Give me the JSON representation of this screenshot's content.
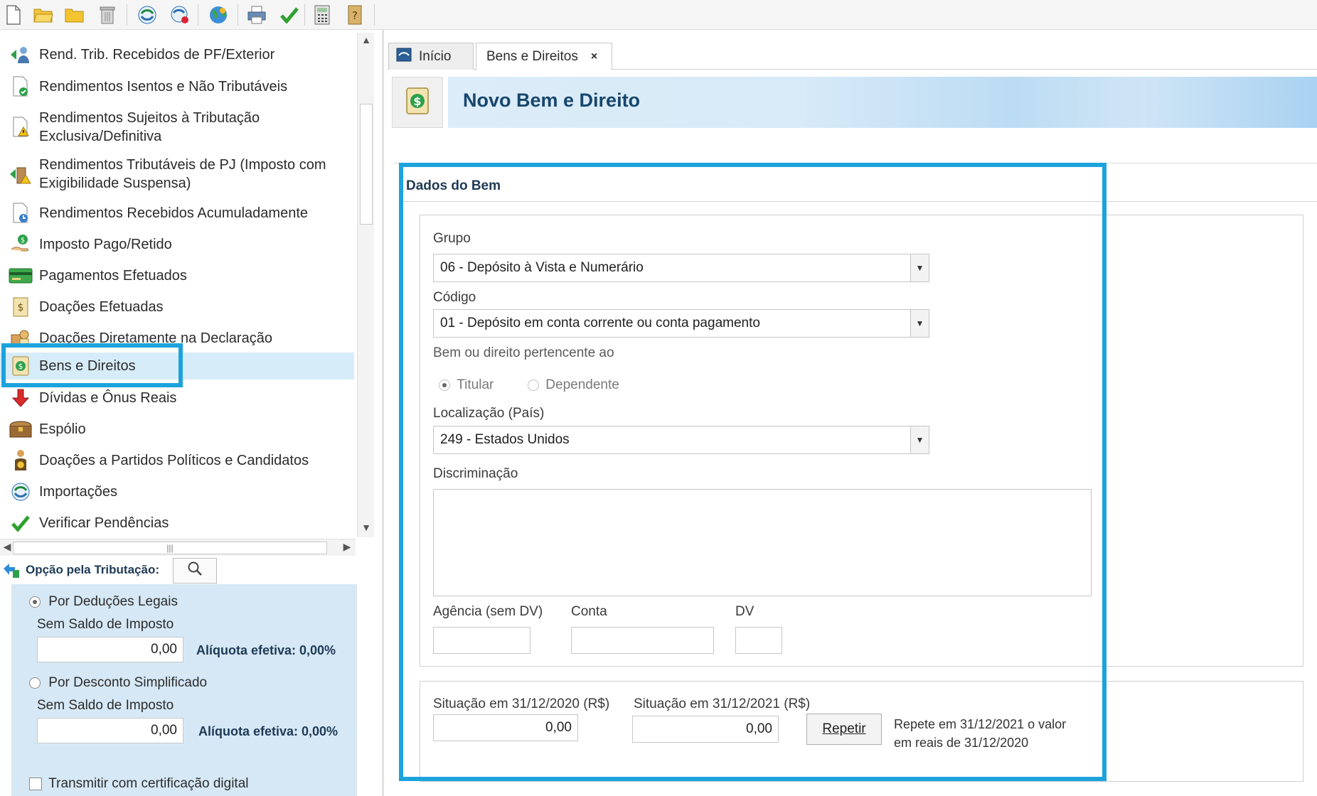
{
  "toolbar": {
    "icons": [
      "new-file-icon",
      "open-folder-icon",
      "folder-icon",
      "trash-icon",
      "import-icon",
      "receita-icon",
      "globe-icon",
      "print-icon",
      "check-icon",
      "calculator-icon",
      "help-icon"
    ]
  },
  "nav": {
    "items": [
      {
        "label": "Rend. Trib. Recebidos de PF/Exterior",
        "icon": "person-arrow-icon"
      },
      {
        "label": "Rendimentos Isentos e Não Tributáveis",
        "icon": "doc-check-icon"
      },
      {
        "label": "Rendimentos Sujeitos à Tributação",
        "label2": "Exclusiva/Definitiva",
        "icon": "doc-warning-icon"
      },
      {
        "label": "Rendimentos Tributáveis de PJ (Imposto com",
        "label2": "Exigibilidade Suspensa)",
        "icon": "building-arrow-icon"
      },
      {
        "label": "Rendimentos Recebidos Acumuladamente",
        "icon": "doc-clock-icon"
      },
      {
        "label": "Imposto Pago/Retido",
        "icon": "hand-coin-icon"
      },
      {
        "label": "Pagamentos Efetuados",
        "icon": "card-icon"
      },
      {
        "label": "Doações Efetuadas",
        "icon": "money-bag-icon"
      },
      {
        "label": "Doações Diretamente na Declaração",
        "icon": "donation-icon"
      },
      {
        "label": "Bens e Direitos",
        "icon": "dollar-doc-icon"
      },
      {
        "label": "Dívidas e Ônus Reais",
        "icon": "down-arrow-icon"
      },
      {
        "label": "Espólio",
        "icon": "chest-icon"
      },
      {
        "label": "Doações a Partidos Políticos e Candidatos",
        "icon": "person-coin-icon"
      },
      {
        "label": "Importações",
        "icon": "import-icon"
      },
      {
        "label": "Verificar Pendências",
        "icon": "check-icon"
      }
    ]
  },
  "opcao": {
    "title": "Opção pela Tributação:",
    "deducoes_label": "Por Deduções Legais",
    "deducoes_saldo": "Sem Saldo de Imposto",
    "deducoes_value": "0,00",
    "deducoes_aliquota": "Alíquota efetiva: 0,00%",
    "simplificado_label": "Por Desconto Simplificado",
    "simplificado_saldo": "Sem Saldo de Imposto",
    "simplificado_value": "0,00",
    "simplificado_aliquota": "Alíquota efetiva: 0,00%",
    "transmitir_label": "Transmitir com certificação digital"
  },
  "tabs": [
    {
      "label": "Início"
    },
    {
      "label": "Bens e Direitos",
      "close": "×"
    }
  ],
  "header": {
    "title": "Novo Bem e Direito"
  },
  "form": {
    "section_title": "Dados do Bem",
    "grupo_label": "Grupo",
    "grupo_value": "06 - Depósito à Vista e Numerário",
    "codigo_label": "Código",
    "codigo_value": "01 - Depósito em conta corrente ou conta pagamento",
    "pertencente_label": "Bem ou direito pertencente ao",
    "titular_label": "Titular",
    "dependente_label": "Dependente",
    "localizacao_label": "Localização (País)",
    "localizacao_value": "249 - Estados Unidos",
    "discriminacao_label": "Discriminação",
    "agencia_label": "Agência (sem DV)",
    "conta_label": "Conta",
    "dv_label": "DV",
    "situacao2020_label": "Situação em 31/12/2020 (R$)",
    "situacao2020_value": "0,00",
    "situacao2021_label": "Situação em 31/12/2021 (R$)",
    "situacao2021_value": "0,00",
    "repetir_label": "Repetir",
    "hint_line1": "Repete em 31/12/2021 o valor",
    "hint_line2": "em reais de 31/12/2020"
  },
  "colors": {
    "highlight": "#1ca3dc",
    "selected_row": "#d7ecf9",
    "title_blue": "#17466d",
    "panel_blue": "#d6e8f5"
  }
}
